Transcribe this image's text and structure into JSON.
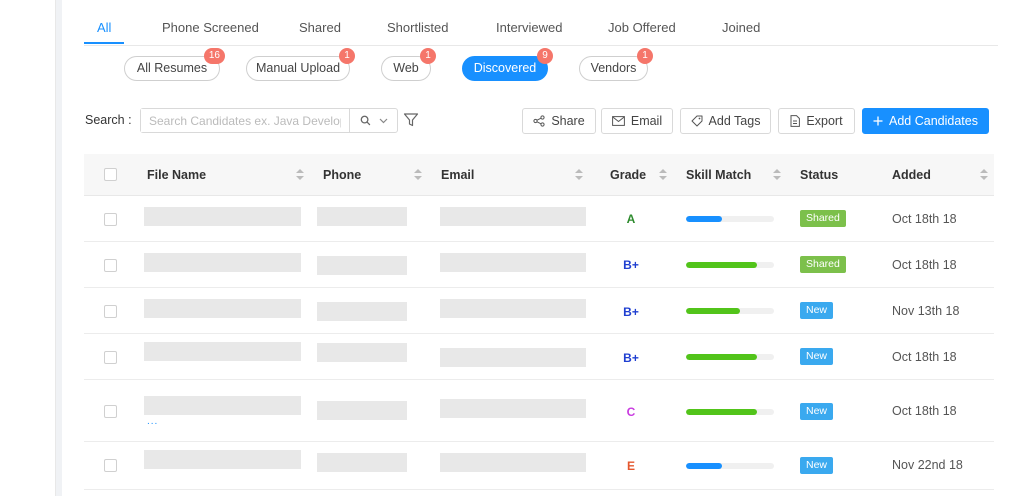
{
  "tabs": [
    {
      "label": "All",
      "active": true
    },
    {
      "label": "Phone Screened"
    },
    {
      "label": "Shared"
    },
    {
      "label": "Shortlisted"
    },
    {
      "label": "Interviewed"
    },
    {
      "label": "Job Offered"
    },
    {
      "label": "Joined"
    }
  ],
  "filters": [
    {
      "label": "All Resumes",
      "count": "16"
    },
    {
      "label": "Manual Upload",
      "count": "1"
    },
    {
      "label": "Web",
      "count": "1"
    },
    {
      "label": "Discovered",
      "count": "9",
      "active": true
    },
    {
      "label": "Vendors",
      "count": "1"
    }
  ],
  "search": {
    "label": "Search :",
    "placeholder": "Search Candidates ex. Java Develop"
  },
  "toolbar": {
    "share": "Share",
    "email": "Email",
    "add_tags": "Add Tags",
    "export": "Export",
    "add_candidates": "Add Candidates"
  },
  "table": {
    "headers": {
      "file_name": "File Name",
      "phone": "Phone",
      "email": "Email",
      "grade": "Grade",
      "skill_match": "Skill Match",
      "status": "Status",
      "added": "Added"
    },
    "rows": [
      {
        "grade": "A",
        "grade_color": "#2e8b2e",
        "skill_match": 0.41,
        "bar_color": "#1890ff",
        "status": "Shared",
        "status_color": "#7cc04b",
        "added": "Oct 18th 18"
      },
      {
        "grade": "B+",
        "grade_color": "#1f3fd1",
        "skill_match": 0.81,
        "bar_color": "#52c41a",
        "status": "Shared",
        "status_color": "#7cc04b",
        "added": "Oct 18th 18"
      },
      {
        "grade": "B+",
        "grade_color": "#1f3fd1",
        "skill_match": 0.61,
        "bar_color": "#52c41a",
        "status": "New",
        "status_color": "#3aa9ef",
        "added": "Nov 13th 18"
      },
      {
        "grade": "B+",
        "grade_color": "#1f3fd1",
        "skill_match": 0.81,
        "bar_color": "#52c41a",
        "status": "New",
        "status_color": "#3aa9ef",
        "added": "Oct 18th 18"
      },
      {
        "grade": "C",
        "grade_color": "#c93be0",
        "skill_match": 0.81,
        "bar_color": "#52c41a",
        "status": "New",
        "status_color": "#3aa9ef",
        "added": "Oct 18th 18",
        "file_note": "..."
      },
      {
        "grade": "E",
        "grade_color": "#e4572e",
        "skill_match": 0.41,
        "bar_color": "#1890ff",
        "status": "New",
        "status_color": "#3aa9ef",
        "added": "Nov 22nd 18"
      }
    ]
  }
}
